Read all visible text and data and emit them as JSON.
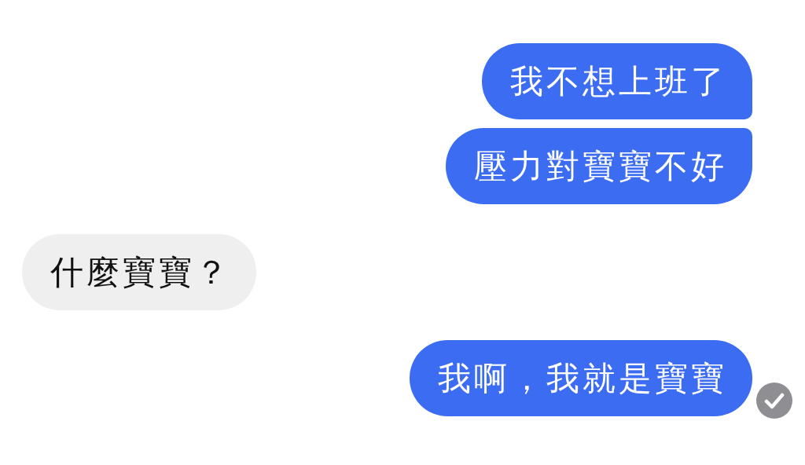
{
  "messages": [
    {
      "kind": "sent",
      "text": "我不想上班了",
      "delivered": false
    },
    {
      "kind": "sent",
      "text": "壓力對寶寶不好",
      "delivered": false
    },
    {
      "kind": "received",
      "text": "什麼寶寶？"
    },
    {
      "kind": "sent",
      "text": "我啊，我就是寶寶",
      "delivered": true
    }
  ]
}
